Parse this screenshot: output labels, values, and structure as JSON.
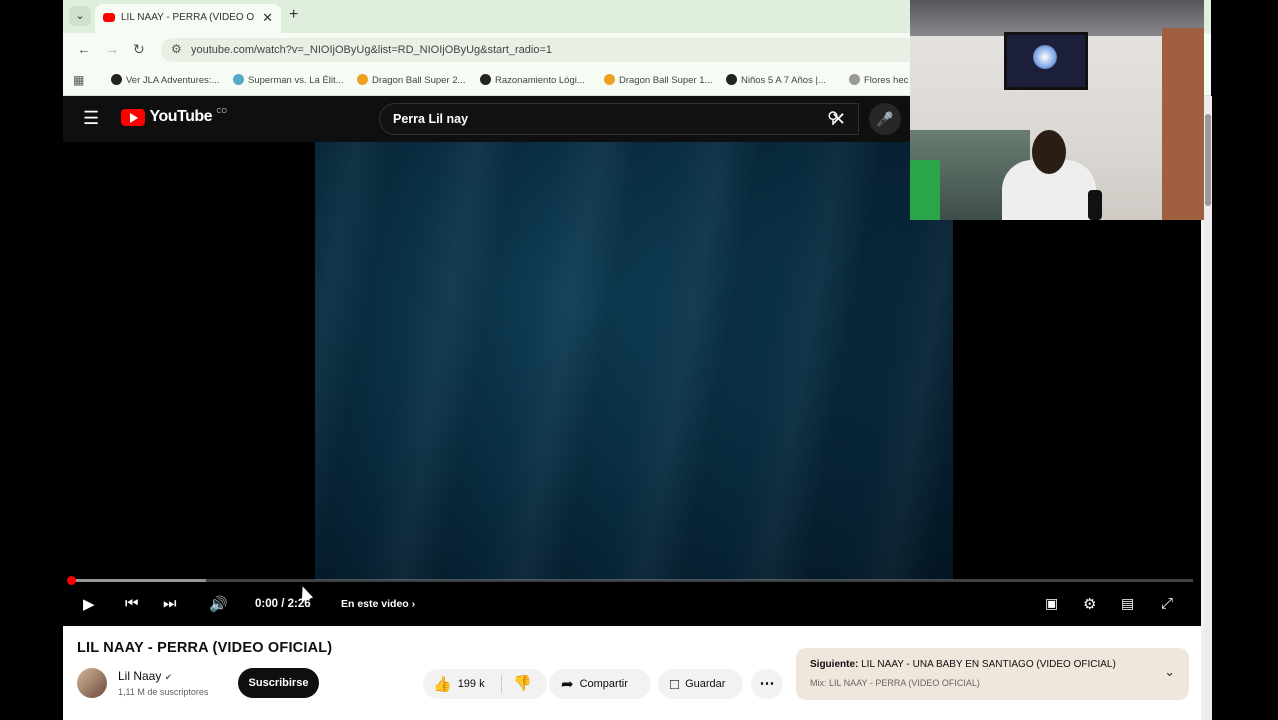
{
  "browser": {
    "tab": {
      "title": "LIL NAAY - PERRA (VIDEO OFIC"
    },
    "url": "youtube.com/watch?v=_NIOIjOByUg&list=RD_NIOIjOByUg&start_radio=1",
    "bookmarks": [
      {
        "label": "Ver JLA Adventures:...",
        "color": "#222222"
      },
      {
        "label": "Superman vs. La Élit...",
        "color": "#58a7c9"
      },
      {
        "label": "Dragon Ball Super 2...",
        "color": "#f0a020"
      },
      {
        "label": "Razonamiento Lógi...",
        "color": "#222222"
      },
      {
        "label": "Dragon Ball Super 1...",
        "color": "#f0a020"
      },
      {
        "label": "Niños 5 A 7 Años |...",
        "color": "#222222"
      },
      {
        "label": "Flores hec",
        "color": "#999999"
      }
    ]
  },
  "youtube": {
    "logo_text": "YouTube",
    "logo_region": "CO",
    "search_query": "Perra Lil nay",
    "player": {
      "time": "0:00 / 2:26",
      "chapter": "En este video",
      "progress": 0.0,
      "buffered": 0.12
    },
    "video": {
      "title": "LIL NAAY - PERRA (VIDEO OFICIAL)",
      "channel": "Lil Naay",
      "subscribers": "1,11 M de suscriptores",
      "subscribe_label": "Suscribirse",
      "likes": "199 k",
      "share_label": "Compartir",
      "save_label": "Guardar"
    },
    "next": {
      "label": "Siguiente:",
      "title": "LIL NAAY - UNA BABY EN SANTIAGO (VIDEO OFICIAL)",
      "mix": "Mix: LIL NAAY - PERRA (VIDEO OFICIAL)"
    }
  },
  "colors": {
    "accent": "#ff0000",
    "header": "#0f0f0f",
    "tabstrip": "#dfeedd"
  }
}
